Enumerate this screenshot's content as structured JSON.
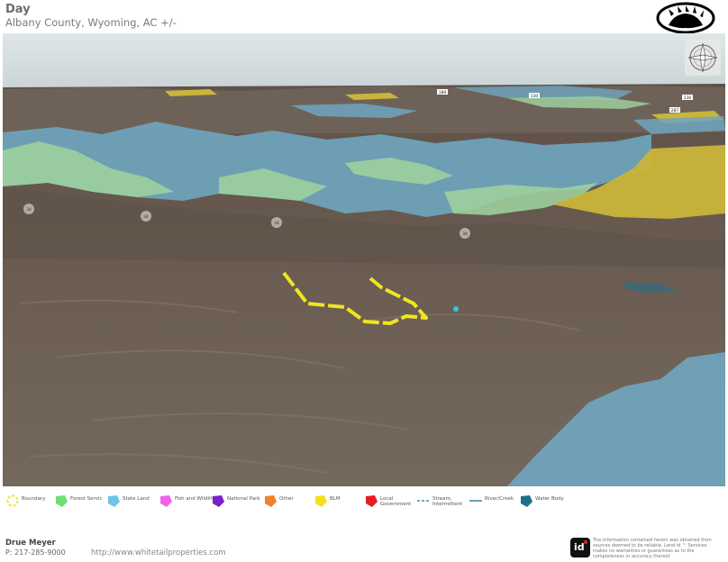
{
  "header": {
    "title": "Day",
    "subtitle": "Albany County, Wyoming,  AC +/-"
  },
  "map": {
    "road_labels": [
      "189",
      "130",
      "287",
      "230",
      "34",
      "34",
      "34",
      "34"
    ],
    "colors": {
      "state_land": "#6fa6c0",
      "forest_service": "#9ccf9c",
      "blm": "#c9b53a",
      "boundary": "#f0e61e",
      "terrain": "#6a5c50",
      "sky": "#d4dde0"
    }
  },
  "legend": {
    "items": [
      {
        "label": "Boundary",
        "color": "#f0e61e",
        "icon": "dashed-circle-icon"
      },
      {
        "label": "Forest Servic",
        "color": "#6ee06e",
        "icon": "polygon-icon"
      },
      {
        "label": "State Land",
        "color": "#6cc5ea",
        "icon": "polygon-icon"
      },
      {
        "label": "Fish and Wildlife",
        "color": "#f064e6",
        "icon": "polygon-icon"
      },
      {
        "label": "National Park",
        "color": "#7a20c8",
        "icon": "polygon-icon"
      },
      {
        "label": "Other",
        "color": "#f08030",
        "icon": "polygon-icon"
      },
      {
        "label": "BLM",
        "color": "#f2e01e",
        "icon": "polygon-icon"
      },
      {
        "label": "Local Government",
        "color": "#e81e1e",
        "icon": "polygon-icon"
      },
      {
        "label": "Stream, Intermittent",
        "color": "#4a8aa8",
        "icon": "dashed-line-icon"
      },
      {
        "label": "River/Creek",
        "color": "#3d7fa0",
        "icon": "line-icon"
      },
      {
        "label": "Water Body",
        "color": "#1f6f8a",
        "icon": "polygon-icon"
      }
    ]
  },
  "footer": {
    "agent_name": "Drue Meyer",
    "phone": "P: 217-285-9000",
    "website": "http://www.whitetailproperties.com",
    "disclaimer": "The information contained herein was obtained from sources deemed to be reliable. Land id ™ Services makes no warranties or guarantees as to the completeness or accuracy thereof."
  }
}
